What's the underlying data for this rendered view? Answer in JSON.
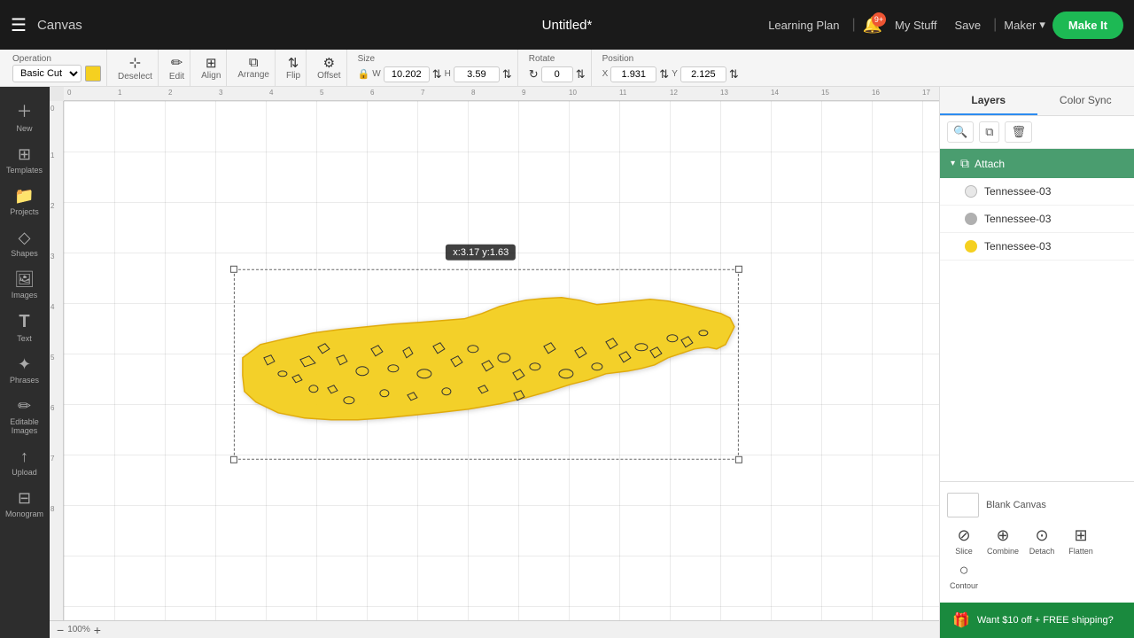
{
  "topbar": {
    "menu_icon": "☰",
    "app_title": "Canvas",
    "doc_title": "Untitled*",
    "learning_plan": "Learning Plan",
    "sep1": "|",
    "my_stuff": "My Stuff",
    "save": "Save",
    "sep2": "|",
    "maker_label": "Maker",
    "make_it": "Make It",
    "notif_count": "9+"
  },
  "toolbar": {
    "operation_label": "Operation",
    "operation_value": "Basic Cut",
    "deselect_label": "Deselect",
    "edit_label": "Edit",
    "align_label": "Align",
    "arrange_label": "Arrange",
    "flip_label": "Flip",
    "offset_label": "Offset",
    "size_label": "Size",
    "rotate_label": "Rotate",
    "rotate_value": "0",
    "position_label": "Position",
    "width_label": "W",
    "width_value": "10.202",
    "height_label": "H",
    "height_value": "3.59",
    "x_label": "X",
    "x_value": "1.931",
    "y_label": "Y",
    "y_value": "2.125"
  },
  "sidebar": {
    "items": [
      {
        "id": "new",
        "icon": "+",
        "label": "New"
      },
      {
        "id": "templates",
        "icon": "⊞",
        "label": "Templates"
      },
      {
        "id": "projects",
        "icon": "📁",
        "label": "Projects"
      },
      {
        "id": "shapes",
        "icon": "◇",
        "label": "Shapes"
      },
      {
        "id": "images",
        "icon": "🖼",
        "label": "Images"
      },
      {
        "id": "text",
        "icon": "T",
        "label": "Text"
      },
      {
        "id": "phrases",
        "icon": "✦",
        "label": "Phrases"
      },
      {
        "id": "editable-images",
        "icon": "✏",
        "label": "Editable Images"
      },
      {
        "id": "upload",
        "icon": "↑",
        "label": "Upload"
      },
      {
        "id": "monogram",
        "icon": "⊟",
        "label": "Monogram"
      }
    ]
  },
  "canvas": {
    "tooltip": "x:3.17 y:1.63",
    "zoom_level": "100%",
    "ruler_labels_h": [
      "0",
      "1",
      "2",
      "3",
      "4",
      "5",
      "6",
      "7",
      "8",
      "9",
      "10",
      "11",
      "12",
      "13",
      "14",
      "15",
      "16",
      "17"
    ],
    "ruler_labels_v": [
      "0",
      "1",
      "2",
      "3",
      "4",
      "5",
      "6",
      "7",
      "8"
    ]
  },
  "layers_panel": {
    "title": "Layers",
    "color_sync": "Color Sync",
    "attach_label": "Attach",
    "layer_items": [
      {
        "name": "Tennessee-03",
        "color": "#e8e8e8"
      },
      {
        "name": "Tennessee-03",
        "color": "#b0b0b0"
      },
      {
        "name": "Tennessee-03",
        "color": "#f5d020"
      }
    ],
    "blank_canvas_label": "Blank Canvas",
    "action_buttons": [
      {
        "id": "slice",
        "icon": "⊘",
        "label": "Slice"
      },
      {
        "id": "combine",
        "icon": "⊕",
        "label": "Combine"
      },
      {
        "id": "detach",
        "icon": "⊙",
        "label": "Detach"
      },
      {
        "id": "flatten",
        "icon": "⊞",
        "label": "Flatten"
      },
      {
        "id": "contour",
        "icon": "○",
        "label": "Contour"
      }
    ]
  },
  "promo": {
    "icon": "🎁",
    "text": "Want $10 off + FREE shipping?"
  }
}
